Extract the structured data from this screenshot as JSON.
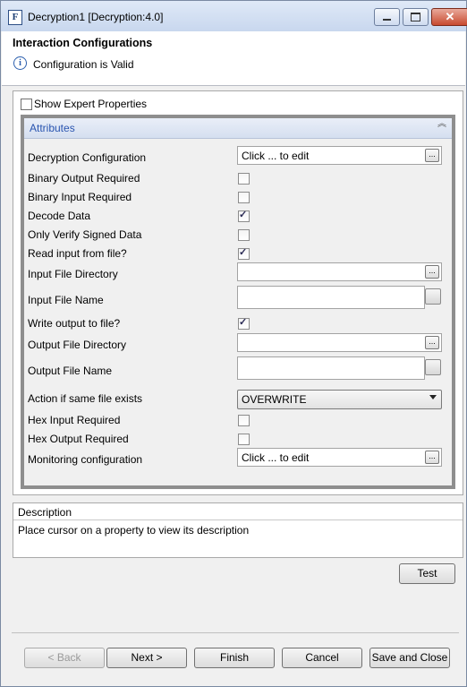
{
  "window": {
    "title": "Decryption1 [Decryption:4.0]",
    "icon_letter": "F"
  },
  "header": {
    "title": "Interaction Configurations",
    "status": "Configuration is Valid"
  },
  "options": {
    "show_expert_label": "Show Expert Properties",
    "show_expert_checked": false
  },
  "attributes": {
    "section_title": "Attributes",
    "decryption_configuration": {
      "label": "Decryption Configuration",
      "value": "Click ... to edit"
    },
    "binary_output_required": {
      "label": "Binary Output Required",
      "checked": false
    },
    "binary_input_required": {
      "label": "Binary Input Required",
      "checked": false
    },
    "decode_data": {
      "label": "Decode Data",
      "checked": true
    },
    "only_verify_signed_data": {
      "label": "Only Verify Signed Data",
      "checked": false
    },
    "read_input_from_file": {
      "label": "Read input from file?",
      "checked": true
    },
    "input_file_directory": {
      "label": "Input File Directory",
      "value": ""
    },
    "input_file_name": {
      "label": "Input File Name",
      "value": ""
    },
    "write_output_to_file": {
      "label": "Write output to file?",
      "checked": true
    },
    "output_file_directory": {
      "label": "Output File Directory",
      "value": ""
    },
    "output_file_name": {
      "label": "Output File Name",
      "value": ""
    },
    "action_if_same_file_exists": {
      "label": "Action if same file exists",
      "value": "OVERWRITE"
    },
    "hex_input_required": {
      "label": "Hex Input Required",
      "checked": false
    },
    "hex_output_required": {
      "label": "Hex Output Required",
      "checked": false
    },
    "monitoring_configuration": {
      "label": "Monitoring configuration",
      "value": "Click ... to edit"
    }
  },
  "description": {
    "title": "Description",
    "text": "Place cursor on a property to view its description"
  },
  "buttons": {
    "test": "Test",
    "back": "< Back",
    "next": "Next >",
    "finish": "Finish",
    "cancel": "Cancel",
    "save_and_close": "Save and Close",
    "ellipsis": "..."
  }
}
